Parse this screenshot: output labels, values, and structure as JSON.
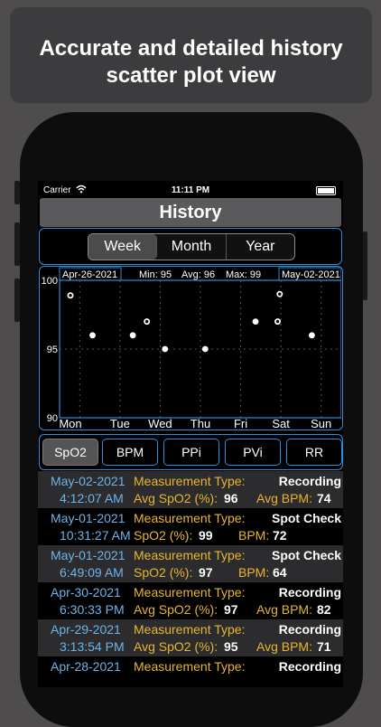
{
  "banner": {
    "line1": "Accurate and detailed history",
    "line2": "scatter plot view"
  },
  "status": {
    "carrier": "Carrier",
    "time": "11:11 PM"
  },
  "nav": {
    "title": "History"
  },
  "range_tabs": [
    {
      "label": "Week",
      "active": true
    },
    {
      "label": "Month",
      "active": false
    },
    {
      "label": "Year",
      "active": false
    }
  ],
  "chart_header": {
    "start": "Apr-26-2021",
    "end": "May-02-2021",
    "min": "Min: 95",
    "avg": "Avg: 96",
    "max": "Max: 99"
  },
  "metrics": [
    {
      "label": "SpO2",
      "active": true
    },
    {
      "label": "BPM",
      "active": false
    },
    {
      "label": "PPi",
      "active": false
    },
    {
      "label": "PVi",
      "active": false
    },
    {
      "label": "RR",
      "active": false
    }
  ],
  "chart_data": {
    "type": "scatter",
    "categories": [
      "Mon",
      "Tue",
      "Wed",
      "Thu",
      "Fri",
      "Sat",
      "Sun"
    ],
    "y_ticks": [
      "100",
      "95",
      "90"
    ],
    "ylim": [
      90,
      100
    ],
    "points": [
      {
        "x": 0,
        "y": 98.9,
        "style": "ring"
      },
      {
        "x": 0.55,
        "y": 96,
        "style": "solid"
      },
      {
        "x": 1.55,
        "y": 96,
        "style": "solid"
      },
      {
        "x": 1.9,
        "y": 97,
        "style": "ring"
      },
      {
        "x": 2.35,
        "y": 95,
        "style": "solid"
      },
      {
        "x": 3.35,
        "y": 95,
        "style": "solid"
      },
      {
        "x": 4.6,
        "y": 97,
        "style": "solid"
      },
      {
        "x": 5.15,
        "y": 97,
        "style": "ring"
      },
      {
        "x": 5.2,
        "y": 99,
        "style": "ring"
      },
      {
        "x": 6,
        "y": 96,
        "style": "solid"
      }
    ],
    "colors": {
      "axis": "#2f8ed8",
      "grid": "#555555",
      "point": "#ffffff"
    }
  },
  "records": [
    {
      "date": "May-02-2021",
      "time": "4:12:07 AM",
      "type_label": "Measurement Type:",
      "type": "Recording",
      "spo2_label": "Avg SpO2 (%):",
      "spo2": "96",
      "bpm_label": "Avg BPM:",
      "bpm": "74"
    },
    {
      "date": "May-01-2021",
      "time": "10:31:27 AM",
      "type_label": "Measurement Type:",
      "type": "Spot Check",
      "spo2_label": "SpO2 (%):",
      "spo2": "99",
      "bpm_label": "BPM:",
      "bpm": "72"
    },
    {
      "date": "May-01-2021",
      "time": "6:49:09 AM",
      "type_label": "Measurement Type:",
      "type": "Spot Check",
      "spo2_label": "SpO2 (%):",
      "spo2": "97",
      "bpm_label": "BPM:",
      "bpm": "64"
    },
    {
      "date": "Apr-30-2021",
      "time": "6:30:33 PM",
      "type_label": "Measurement Type:",
      "type": "Recording",
      "spo2_label": "Avg SpO2 (%):",
      "spo2": "97",
      "bpm_label": "Avg BPM:",
      "bpm": "82"
    },
    {
      "date": "Apr-29-2021",
      "time": "3:13:54 PM",
      "type_label": "Measurement Type:",
      "type": "Recording",
      "spo2_label": "Avg SpO2 (%):",
      "spo2": "95",
      "bpm_label": "Avg BPM:",
      "bpm": "71"
    },
    {
      "date": "Apr-28-2021",
      "time": "",
      "type_label": "Measurement Type:",
      "type": "Recording",
      "spo2_label": "",
      "spo2": "",
      "bpm_label": "",
      "bpm": ""
    }
  ]
}
